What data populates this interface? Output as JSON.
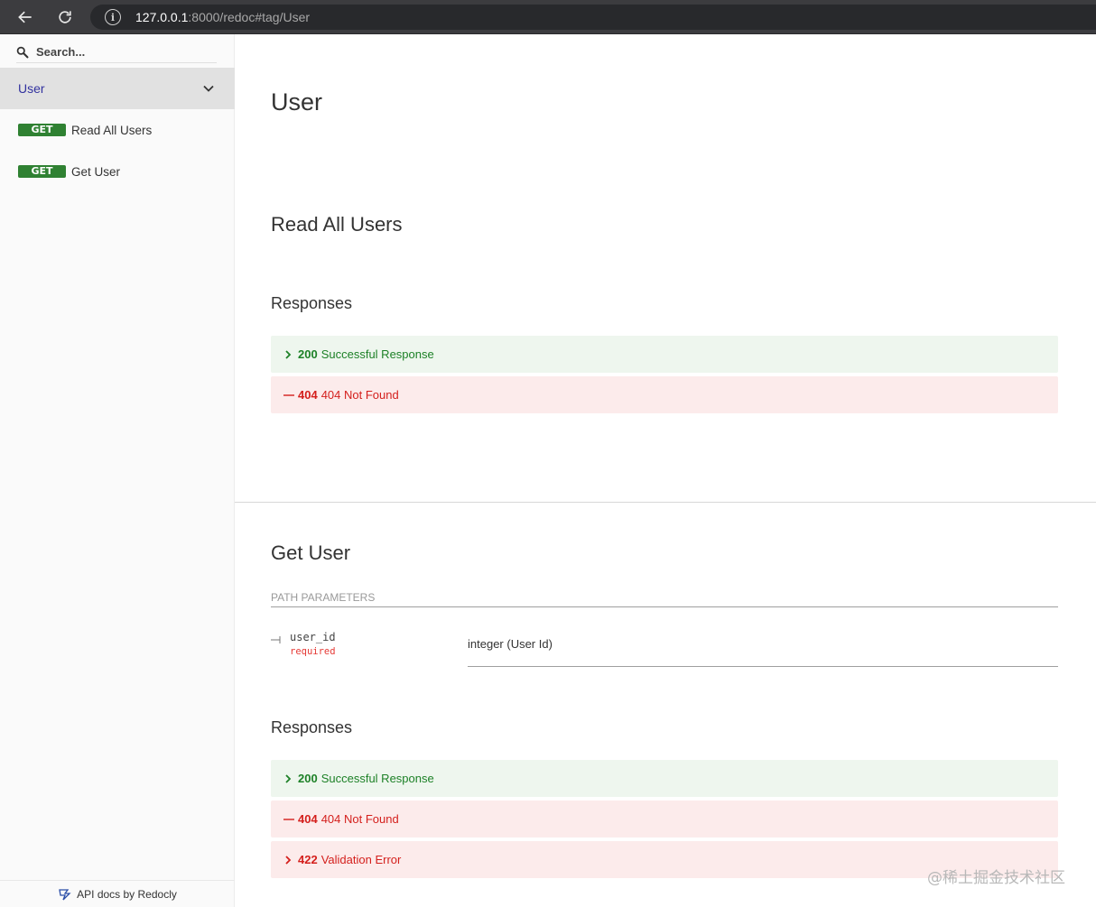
{
  "browser": {
    "url_host": "127.0.0.1",
    "url_rest": ":8000/redoc#tag/User"
  },
  "sidebar": {
    "search_placeholder": "Search...",
    "tag_label": "User",
    "operations": [
      {
        "method": "GET",
        "label": "Read All Users"
      },
      {
        "method": "GET",
        "label": "Get User"
      }
    ],
    "footer": "API docs by Redocly"
  },
  "main": {
    "tag_title": "User",
    "op1": {
      "title": "Read All Users",
      "responses_heading": "Responses",
      "responses": [
        {
          "code": "200",
          "text": "Successful Response",
          "kind": "success",
          "marker": "chevron"
        },
        {
          "code": "404",
          "text": "404 Not Found",
          "kind": "error",
          "marker": "dash"
        }
      ]
    },
    "op2": {
      "title": "Get User",
      "params_heading": "PATH PARAMETERS",
      "param": {
        "name": "user_id",
        "required": "required",
        "type": "integer (User Id)"
      },
      "responses_heading": "Responses",
      "responses": [
        {
          "code": "200",
          "text": "Successful Response",
          "kind": "success",
          "marker": "chevron"
        },
        {
          "code": "404",
          "text": "404 Not Found",
          "kind": "error",
          "marker": "dash"
        },
        {
          "code": "422",
          "text": "Validation Error",
          "kind": "error",
          "marker": "chevron"
        }
      ]
    }
  },
  "watermark": "@稀土掘金技术社区",
  "colors": {
    "success": "#1d8127",
    "error": "#d41f1c",
    "get_badge": "#2f8132",
    "tag_active": "#32329f"
  }
}
